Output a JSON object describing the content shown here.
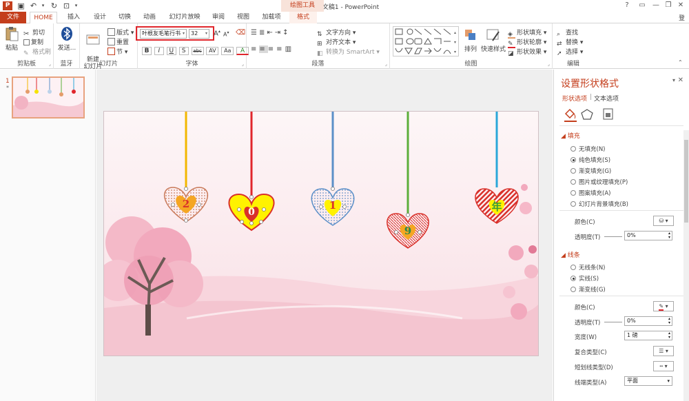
{
  "window": {
    "doc_title": "演示文稿1 - PowerPoint",
    "context_title": "绘图工具",
    "help": "?",
    "minimize": "—",
    "restore": "❐",
    "close": "✕",
    "app_logo": "P"
  },
  "tabs": [
    {
      "label": "文件",
      "name": "tab-file"
    },
    {
      "label": "HOME",
      "name": "tab-home"
    },
    {
      "label": "插入",
      "name": "tab-insert"
    },
    {
      "label": "设计",
      "name": "tab-design"
    },
    {
      "label": "切换",
      "name": "tab-transitions"
    },
    {
      "label": "动画",
      "name": "tab-animations"
    },
    {
      "label": "幻灯片放映",
      "name": "tab-slideshow"
    },
    {
      "label": "审阅",
      "name": "tab-review"
    },
    {
      "label": "视图",
      "name": "tab-view"
    },
    {
      "label": "加载项",
      "name": "tab-addins"
    },
    {
      "label": "格式",
      "name": "tab-format"
    }
  ],
  "account_label": "登",
  "ribbon": {
    "clipboard": {
      "paste": "粘贴",
      "cut": "剪切",
      "copy": "复制",
      "format_painter": "格式刷",
      "label": "剪贴板"
    },
    "bluetooth": {
      "send": "发送...",
      "label": "蓝牙"
    },
    "slides": {
      "new_slide": "新建\n幻灯片",
      "layout": "版式",
      "reset": "重置",
      "section": "节",
      "label": "幻灯片"
    },
    "font": {
      "font_name": "叶根友毛笔行书",
      "font_size": "32",
      "label": "字体",
      "bold": "B",
      "italic": "I",
      "underline": "U",
      "shadow": "S",
      "strike": "abc",
      "spacing": "AV",
      "case": "Aa",
      "color": "A",
      "grow": "A",
      "shrink": "A"
    },
    "paragraph": {
      "text_direction": "文字方向",
      "align_text": "对齐文本",
      "smartart": "转换为 SmartArt",
      "label": "段落"
    },
    "drawing": {
      "arrange": "排列",
      "quick_styles": "快速样式",
      "fill": "形状填充",
      "outline": "形状轮廓",
      "effects": "形状效果",
      "label": "绘图"
    },
    "editing": {
      "find": "查找",
      "replace": "替换",
      "select": "选择",
      "label": "编辑"
    }
  },
  "thumbnails": {
    "slide_number": "1",
    "star": "*"
  },
  "hearts": [
    {
      "digit": "2",
      "color": "#d9302a"
    },
    {
      "digit": "0",
      "color": "#d9302a"
    },
    {
      "digit": "1",
      "color": "#d9302a"
    },
    {
      "digit": "9",
      "color": "#2a8a4a"
    },
    {
      "digit": "年",
      "color": "#3a9a3a"
    }
  ],
  "pane": {
    "title": "设置形状格式",
    "tab_shape": "形状选项",
    "tab_text": "文本选项",
    "fill_section": "填充",
    "fill_options": [
      {
        "label": "无填充(N)",
        "selected": false
      },
      {
        "label": "纯色填充(S)",
        "selected": true
      },
      {
        "label": "渐变填充(G)",
        "selected": false
      },
      {
        "label": "图片或纹理填充(P)",
        "selected": false
      },
      {
        "label": "图案填充(A)",
        "selected": false
      },
      {
        "label": "幻灯片背景填充(B)",
        "selected": false
      }
    ],
    "fill_color_label": "颜色(C)",
    "fill_transparency_label": "透明度(T)",
    "fill_transparency_value": "0%",
    "line_section": "线条",
    "line_options": [
      {
        "label": "无线条(N)",
        "selected": false
      },
      {
        "label": "实线(S)",
        "selected": true
      },
      {
        "label": "渐变线(G)",
        "selected": false
      }
    ],
    "line_color_label": "颜色(C)",
    "line_transparency_label": "透明度(T)",
    "line_transparency_value": "0%",
    "width_label": "宽度(W)",
    "width_value": "1 磅",
    "compound_label": "复合类型(C)",
    "dash_label": "短划线类型(D)",
    "cap_label": "线端类型(A)",
    "cap_value": "平面"
  },
  "colors": {
    "accent": "#c43e1c",
    "highlight": "#e0262c"
  }
}
